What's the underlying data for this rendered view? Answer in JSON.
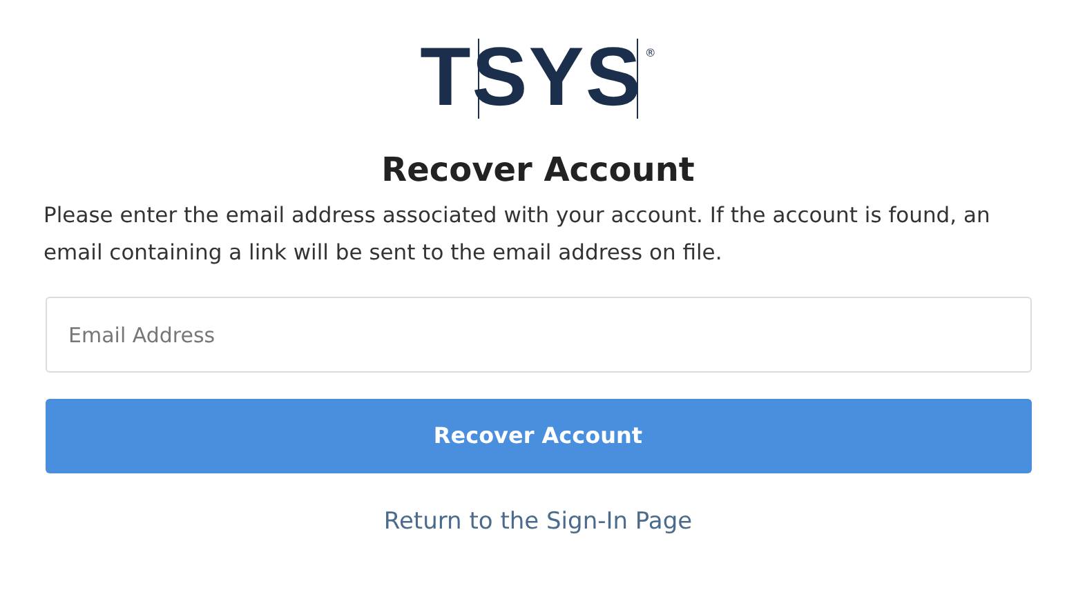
{
  "logo": {
    "text": "TSYS",
    "mark": "®"
  },
  "title": "Recover Account",
  "description": "Please enter the email address associated with your account. If the account is found, an email containing a link will be sent to the email address on file.",
  "email_field": {
    "placeholder": "Email Address"
  },
  "submit_button": "Recover Account",
  "return_link": "Return to the Sign-In Page"
}
